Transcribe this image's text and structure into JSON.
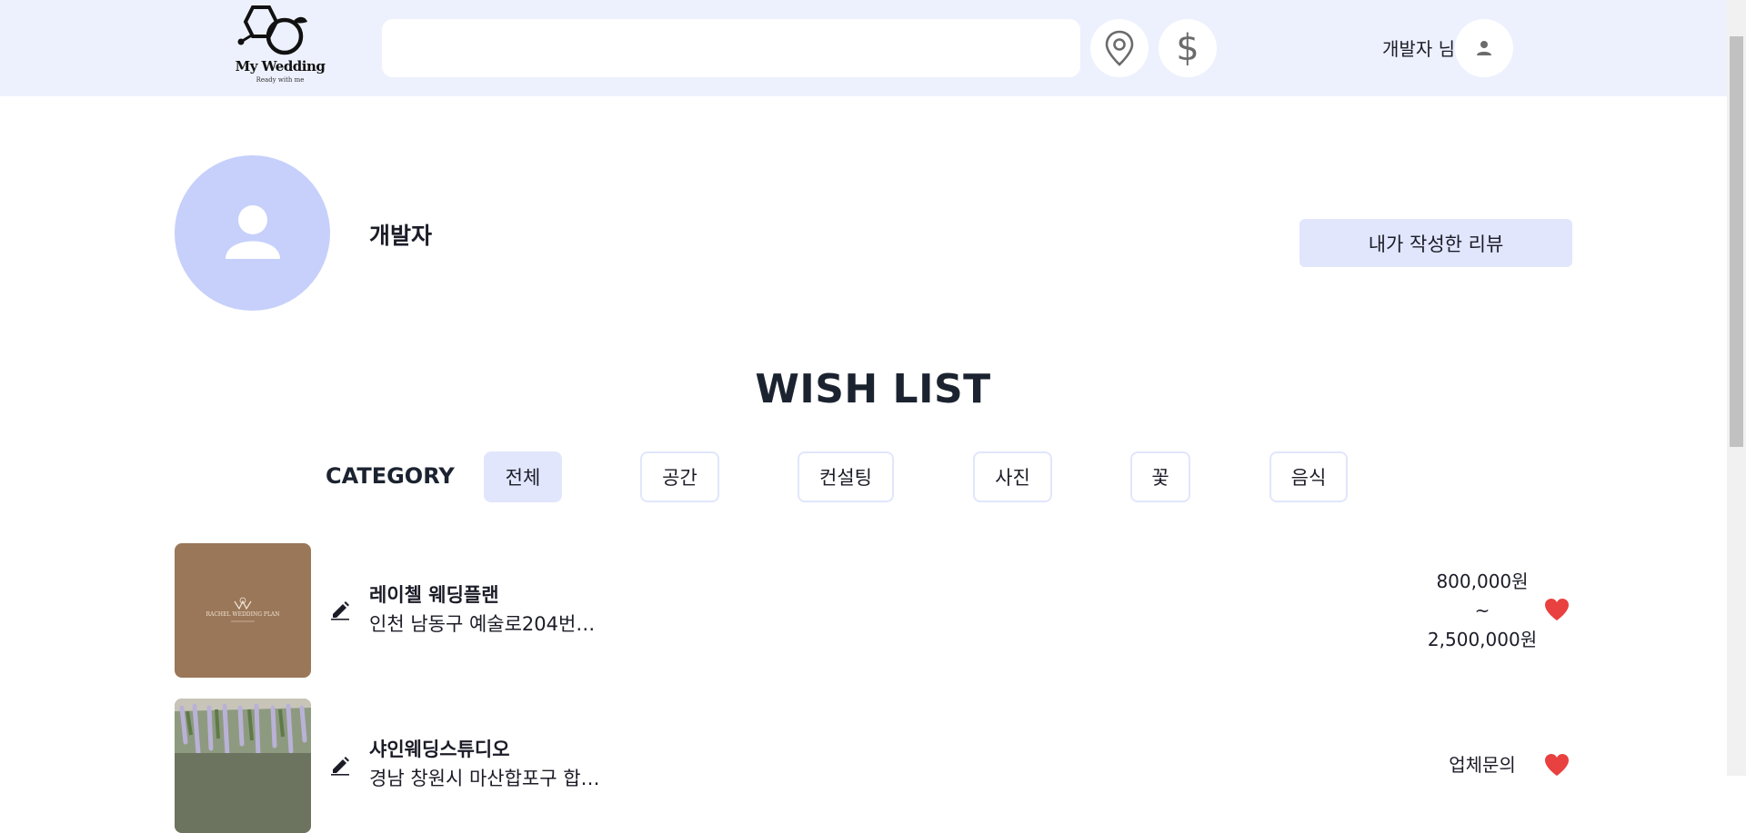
{
  "header": {
    "logo_title": "My Wedding",
    "logo_subtitle": "Ready with me",
    "search": {
      "value": "",
      "placeholder": ""
    },
    "location_icon": "map-pin-icon",
    "price_symbol": "$",
    "user_name": "개발자 님",
    "avatar_icon": "person-icon"
  },
  "profile": {
    "name": "개발자",
    "review_button": "내가 작성한 리뷰"
  },
  "wishlist": {
    "title": "WISH LIST",
    "category_label": "CATEGORY",
    "categories": [
      {
        "label": "전체",
        "active": true
      },
      {
        "label": "공간",
        "active": false
      },
      {
        "label": "컨설팅",
        "active": false
      },
      {
        "label": "사진",
        "active": false
      },
      {
        "label": "꽃",
        "active": false
      },
      {
        "label": "음식",
        "active": false
      }
    ],
    "items": [
      {
        "name": "레이첼 웨딩플랜",
        "address": "인천 남동구 예술로204번…",
        "price_min": "800,000원",
        "price_sep": "~",
        "price_max": "2,500,000원",
        "image_logo_text": "RACHEL WEDDING PLAN",
        "liked": true
      },
      {
        "name": "샤인웨딩스튜디오",
        "address": "경남 창원시 마산합포구 합…",
        "price_label": "업체문의",
        "liked": true
      }
    ]
  },
  "colors": {
    "header_bg": "#edf1fd",
    "accent": "#e1e6fc",
    "avatar_bg": "#c6d0fb",
    "heart": "#e8413f"
  }
}
